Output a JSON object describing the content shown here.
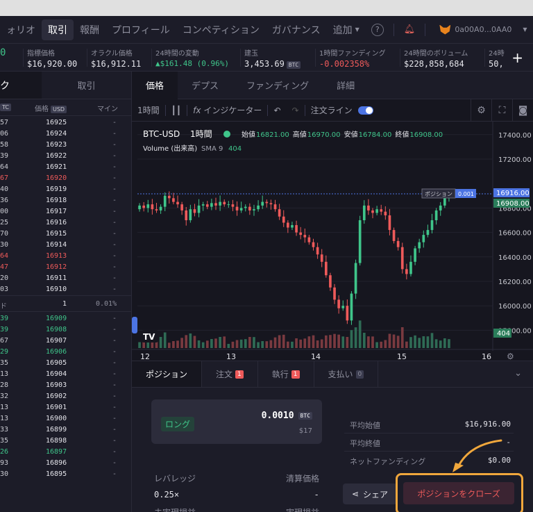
{
  "nav": {
    "items": [
      {
        "label": "ォリオ",
        "active": false
      },
      {
        "label": "取引",
        "active": true
      },
      {
        "label": "報酬",
        "active": false
      },
      {
        "label": "プロフィール",
        "active": false
      },
      {
        "label": "コンペティション",
        "active": false
      },
      {
        "label": "ガバナンス",
        "active": false
      }
    ],
    "more_label": "追加",
    "help_icon": "question-circle-icon",
    "wallet_address": "0a00A0...0AA0"
  },
  "stats": [
    {
      "label": "",
      "value": "0"
    },
    {
      "label": "指標価格",
      "value": "$16,920.00"
    },
    {
      "label": "オラクル価格",
      "value": "$16,912.11"
    },
    {
      "label": "24時間の変動",
      "value": "▲$161.48 (0.96%)",
      "tone": "green"
    },
    {
      "label": "建玉",
      "value": "3,453.69",
      "badge": "BTC"
    },
    {
      "label": "1時間ファンディング",
      "value": "-0.002358%",
      "tone": "red"
    },
    {
      "label": "24時間のボリューム",
      "value": "$228,858,684"
    },
    {
      "label": "24時",
      "value": "50,"
    }
  ],
  "orderbook": {
    "tabs": [
      "ク",
      "取引"
    ],
    "headers": {
      "amount_badge": "TC",
      "price": "価格",
      "price_badge": "USD",
      "mine": "マイン"
    },
    "asks": [
      {
        "a": "57",
        "p": "16925"
      },
      {
        "a": "06",
        "p": "16924"
      },
      {
        "a": "58",
        "p": "16923"
      },
      {
        "a": "39",
        "p": "16922"
      },
      {
        "a": "64",
        "p": "16921"
      },
      {
        "a": "67",
        "p": "16920",
        "tone": "red"
      },
      {
        "a": "40",
        "p": "16919"
      },
      {
        "a": "36",
        "p": "16918"
      },
      {
        "a": "00",
        "p": "16917"
      },
      {
        "a": "25",
        "p": "16916"
      },
      {
        "a": "70",
        "p": "16915"
      },
      {
        "a": "30",
        "p": "16914"
      },
      {
        "a": "64",
        "p": "16913",
        "tone": "red"
      },
      {
        "a": "47",
        "p": "16912",
        "tone": "red"
      },
      {
        "a": "20",
        "p": "16911"
      },
      {
        "a": "03",
        "p": "16910"
      }
    ],
    "spread": {
      "label": "ド",
      "value": "1",
      "pct": "0.01%"
    },
    "bids": [
      {
        "a": "39",
        "p": "16909",
        "tone": "green"
      },
      {
        "a": "39",
        "p": "16908",
        "tone": "green"
      },
      {
        "a": "67",
        "p": "16907"
      },
      {
        "a": "29",
        "p": "16906",
        "tone": "green"
      },
      {
        "a": "35",
        "p": "16905"
      },
      {
        "a": "13",
        "p": "16904"
      },
      {
        "a": "28",
        "p": "16903"
      },
      {
        "a": "32",
        "p": "16902"
      },
      {
        "a": "13",
        "p": "16901"
      },
      {
        "a": "13",
        "p": "16900"
      },
      {
        "a": "33",
        "p": "16899"
      },
      {
        "a": "35",
        "p": "16898"
      },
      {
        "a": "26",
        "p": "16897",
        "tone": "green"
      },
      {
        "a": "93",
        "p": "16896"
      },
      {
        "a": "30",
        "p": "16895"
      }
    ],
    "mine_placeholder": "-"
  },
  "chart_panel": {
    "tabs": [
      "価格",
      "デプス",
      "ファンディング",
      "詳細"
    ],
    "tools": {
      "interval": "1時間",
      "indicators": "インジケーター",
      "order_lines": "注文ライン"
    }
  },
  "chart_data": {
    "type": "candlestick",
    "symbol": "BTC-USD",
    "interval": "1時間",
    "ohlc_legend": {
      "open_label": "始値",
      "open": "16821.00",
      "high_label": "高値",
      "high": "16970.00",
      "low_label": "安値",
      "low": "16784.00",
      "close_label": "終値",
      "close": "16908.00"
    },
    "volume_legend": {
      "label": "Volume (出来高)",
      "sma": "SMA 9",
      "value": "404"
    },
    "y_ticks": [
      17400,
      17200,
      16800,
      16600,
      16400,
      16200,
      16000,
      15800
    ],
    "ylim": [
      15700,
      17450
    ],
    "x_ticks": [
      "12",
      "13",
      "14",
      "15",
      "16"
    ],
    "price_labels": [
      {
        "value": "16916.00",
        "tone": "blue"
      },
      {
        "value": "16908.00",
        "tone": "green"
      }
    ],
    "volume_label": "404",
    "position_label": "ポジション",
    "position_size_label": "0.001",
    "position_price": 16916,
    "closes": [
      16820,
      16800,
      16830,
      16790,
      16780,
      16810,
      16900,
      16880,
      16850,
      16830,
      16780,
      16700,
      16790,
      16760,
      16820,
      16830,
      16810,
      16840,
      16820,
      16850,
      16830,
      16830,
      16810,
      16780,
      16800,
      16810,
      16780,
      16790,
      16820,
      16850,
      16840,
      16830,
      16790,
      16730,
      16680,
      16640,
      16660,
      16600,
      16580,
      16560,
      16520,
      16480,
      16420,
      16360,
      16250,
      16150,
      16050,
      15980,
      16000,
      15880,
      16100,
      16350,
      16700,
      16820,
      16780,
      16760,
      16790,
      16770,
      16740,
      16620,
      16530,
      16480,
      16300,
      16260,
      16360,
      16470,
      16520,
      16580,
      16620,
      16700,
      16780,
      16820,
      16880,
      16908
    ]
  },
  "bottom": {
    "tabs": [
      {
        "label": "ポジション",
        "active": true
      },
      {
        "label": "注文",
        "count": "1",
        "tone": "red"
      },
      {
        "label": "執行",
        "count": "1",
        "tone": "red"
      },
      {
        "label": "支払い",
        "count": "0",
        "tone": "gray"
      }
    ],
    "position": {
      "side": "ロング",
      "size": "0.0010",
      "size_badge": "BTC",
      "usd": "$17"
    },
    "leverage_label": "レバレッジ",
    "leverage_value": "0.25×",
    "liq_label": "清算価格",
    "liq_value": "-",
    "upnl_label": "未実現損益",
    "rpnl_label": "実現損益",
    "info": [
      {
        "k": "平均始値",
        "v": "$16,916.00"
      },
      {
        "k": "平均終値",
        "v": "-"
      },
      {
        "k": "ネットファンディング",
        "v": "$0.00"
      }
    ],
    "share_label": "シェア",
    "close_label": "ポジションをクローズ"
  },
  "colors": {
    "up": "#3fc58a",
    "down": "#ee5a5a",
    "accent": "#4c74e3",
    "highlight": "#f0a73c"
  }
}
